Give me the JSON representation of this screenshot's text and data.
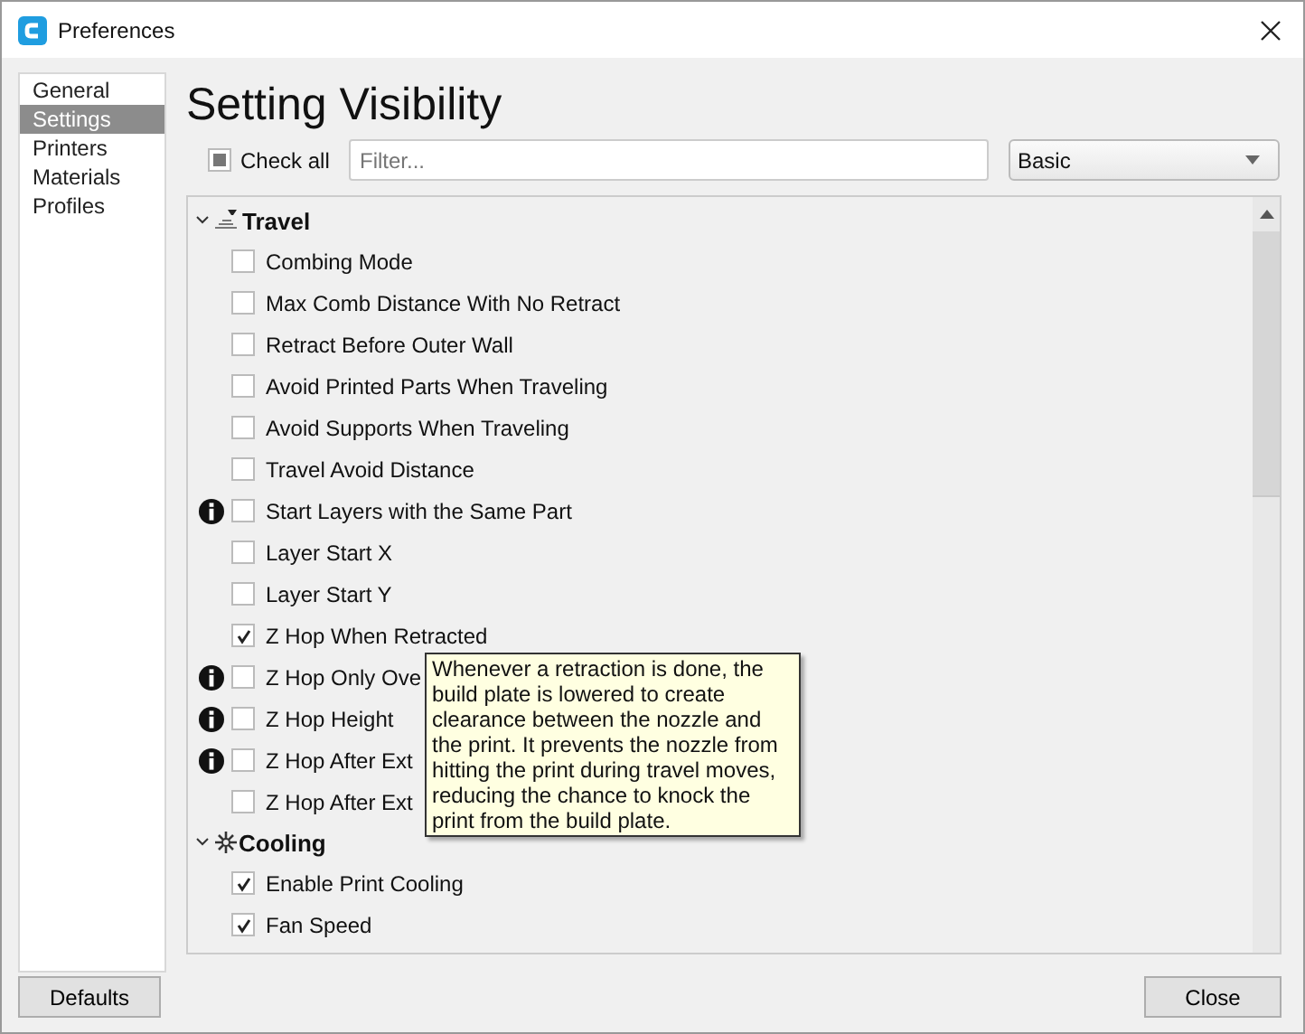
{
  "window": {
    "title": "Preferences"
  },
  "sidebar": {
    "items": [
      {
        "label": "General",
        "selected": false
      },
      {
        "label": "Settings",
        "selected": true
      },
      {
        "label": "Printers",
        "selected": false
      },
      {
        "label": "Materials",
        "selected": false
      },
      {
        "label": "Profiles",
        "selected": false
      }
    ]
  },
  "heading": "Setting Visibility",
  "check_all": {
    "label": "Check all",
    "checked": false,
    "partial": true
  },
  "filter": {
    "placeholder": "Filter..."
  },
  "preset": {
    "value": "Basic"
  },
  "settings": [
    {
      "kind": "category",
      "label": "Travel",
      "expanded": true
    },
    {
      "kind": "setting",
      "label": "Combing Mode",
      "checked": false,
      "info": false
    },
    {
      "kind": "setting",
      "label": "Max Comb Distance With No Retract",
      "checked": false,
      "info": false
    },
    {
      "kind": "setting",
      "label": "Retract Before Outer Wall",
      "checked": false,
      "info": false
    },
    {
      "kind": "setting",
      "label": "Avoid Printed Parts When Traveling",
      "checked": false,
      "info": false
    },
    {
      "kind": "setting",
      "label": "Avoid Supports When Traveling",
      "checked": false,
      "info": false
    },
    {
      "kind": "setting",
      "label": "Travel Avoid Distance",
      "checked": false,
      "info": false
    },
    {
      "kind": "setting",
      "label": "Start Layers with the Same Part",
      "checked": false,
      "info": true
    },
    {
      "kind": "setting",
      "label": "Layer Start X",
      "checked": false,
      "info": false
    },
    {
      "kind": "setting",
      "label": "Layer Start Y",
      "checked": false,
      "info": false
    },
    {
      "kind": "setting",
      "label": "Z Hop When Retracted",
      "checked": true,
      "info": false
    },
    {
      "kind": "setting",
      "label": "Z Hop Only Ove",
      "checked": false,
      "info": true
    },
    {
      "kind": "setting",
      "label": "Z Hop Height",
      "checked": false,
      "info": true
    },
    {
      "kind": "setting",
      "label": "Z Hop After Ext",
      "checked": false,
      "info": true
    },
    {
      "kind": "setting",
      "label": "Z Hop After Ext",
      "checked": false,
      "info": false
    },
    {
      "kind": "category",
      "label": "Cooling",
      "expanded": true
    },
    {
      "kind": "setting",
      "label": "Enable Print Cooling",
      "checked": true,
      "info": false
    },
    {
      "kind": "setting",
      "label": "Fan Speed",
      "checked": true,
      "info": false
    }
  ],
  "tooltip": "Whenever a retraction is done, the build plate is lowered to create clearance between the nozzle and the print. It prevents the nozzle from hitting the print during travel moves, reducing the chance to knock the print from the build plate.",
  "buttons": {
    "left": "Defaults",
    "right": "Close"
  }
}
